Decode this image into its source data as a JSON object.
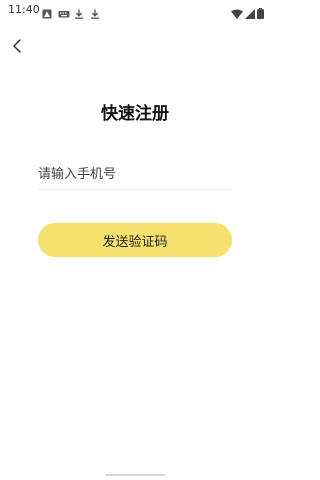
{
  "status_bar": {
    "time": "11:40",
    "left_icons": [
      "photo-notification-icon",
      "keyboard-icon",
      "download-icon",
      "download-icon"
    ],
    "right_icons": [
      "wifi-icon",
      "cellular-signal-icon",
      "battery-icon"
    ]
  },
  "nav": {
    "back_icon": "chevron-left-icon"
  },
  "page": {
    "title": "快速注册"
  },
  "form": {
    "phone_value": "",
    "phone_placeholder": "请输入手机号",
    "send_code_label": "发送验证码"
  },
  "colors": {
    "button": "#f6e06e",
    "divider": "#efefef",
    "text": "#111111"
  }
}
